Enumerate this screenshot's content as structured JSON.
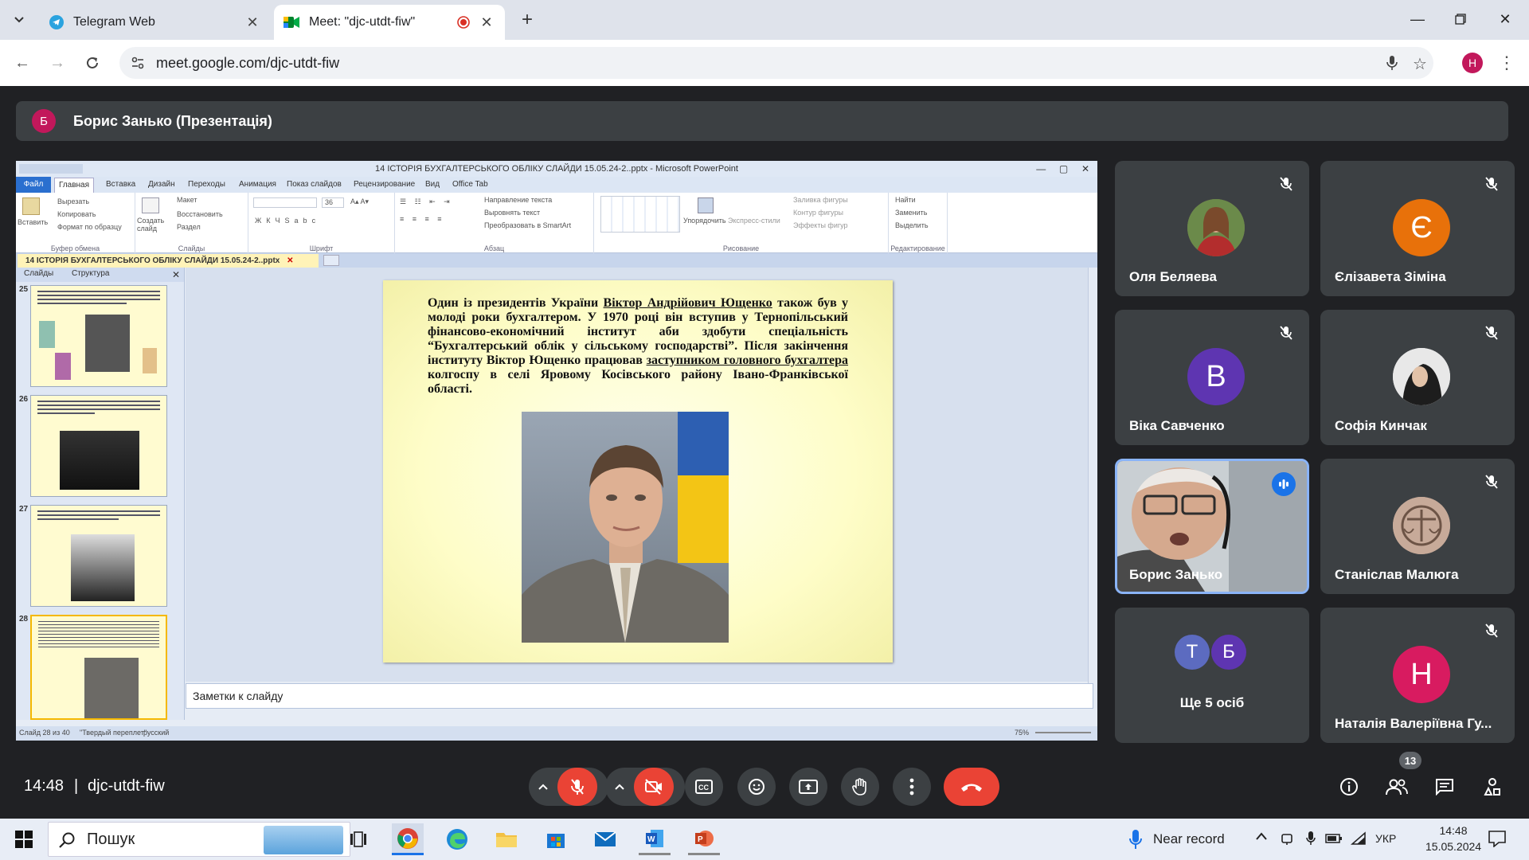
{
  "browser": {
    "tabs": [
      {
        "title": "Telegram Web",
        "favicon": "telegram-icon"
      },
      {
        "title": "Meet: \"djc-utdt-fiw\"",
        "favicon": "meet-icon",
        "recording": true
      }
    ],
    "url": "meet.google.com/djc-utdt-fiw",
    "profile_initial": "H",
    "colors": {
      "tabstrip": "#dfe3eb",
      "profile": "#c2185b"
    }
  },
  "meet": {
    "presenter_banner": {
      "initial": "Б",
      "text": "Борис Занько (Презентація)"
    },
    "presentation": {
      "window_title": "14 ІСТОРІЯ БУХГАЛТЕРСЬКОГО ОБЛІКУ СЛАЙДИ 15.05.24-2..pptx - Microsoft PowerPoint",
      "ribbon_tabs": [
        "Файл",
        "Главная",
        "Вставка",
        "Дизайн",
        "Переходы",
        "Анимация",
        "Показ слайдов",
        "Рецензирование",
        "Вид",
        "Office Tab"
      ],
      "ribbon_groups": {
        "clipboard": {
          "label": "Буфер обмена",
          "paste": "Вставить",
          "cut": "Вырезать",
          "copy": "Копировать",
          "format": "Формат по образцу"
        },
        "slides": {
          "label": "Слайды",
          "new": "Создать слайд",
          "layout": "Макет",
          "reset": "Восстановить",
          "section": "Раздел"
        },
        "font": {
          "label": "Шрифт",
          "size": "36"
        },
        "paragraph": {
          "label": "Абзац",
          "direction": "Направление текста",
          "align": "Выровнять текст",
          "smartart": "Преобразовать в SmartArt"
        },
        "drawing": {
          "label": "Рисование",
          "arrange": "Упорядочить",
          "styles": "Экспресс-стили",
          "fill": "Заливка фигуры",
          "outline": "Контур фигуры",
          "effects": "Эффекты фигур"
        },
        "editing": {
          "label": "Редактирование",
          "find": "Найти",
          "replace": "Заменить",
          "select": "Выделить"
        }
      },
      "doc_tab": "14 ІСТОРІЯ БУХГАЛТЕРСЬКОГО ОБЛІКУ СЛАЙДИ 15.05.24-2..pptx",
      "panel_tabs": [
        "Слайды",
        "Структура"
      ],
      "thumbnails": [
        {
          "num": "25",
          "selected": false
        },
        {
          "num": "26",
          "selected": false
        },
        {
          "num": "27",
          "selected": false
        },
        {
          "num": "28",
          "selected": true
        }
      ],
      "slide": {
        "text_1": "Один із президентів України ",
        "link_1": "Віктор Андрійович Ющенко",
        "text_2": " також був у молоді роки бухгалтером. У 1970 році він вступив у Тернопільський фінансово-економічний інститут аби здобути спеціальність “Бухгалтерський облік у сільському господарстві”. Після закінчення інституту Віктор Ющенко працював ",
        "link_2": "заступником головного бухгалтера",
        "text_3": " колгоспу в селі Яровому Косівського району Івано-Франківської області."
      },
      "notes_placeholder": "Заметки к слайду",
      "status": {
        "slide_count": "Слайд 28 из 40",
        "theme": "\"Твердый переплет\"",
        "language": "русский",
        "zoom": "75%"
      }
    },
    "participants": [
      {
        "name": "Оля Беляева",
        "avatar": "photo",
        "muted": true
      },
      {
        "name": "Єлізавета Зіміна",
        "initial": "Є",
        "color": "#e8710a",
        "muted": true
      },
      {
        "name": "Віка Савченко",
        "initial": "В",
        "color": "#5e35b1",
        "muted": true
      },
      {
        "name": "Софія Кинчак",
        "avatar": "photo",
        "muted": true
      },
      {
        "name": "Борис Занько",
        "avatar": "video",
        "speaking": true
      },
      {
        "name": "Станіслав Малюга",
        "avatar": "photo",
        "muted": true
      },
      {
        "name": "Ще 5 осіб",
        "initials": [
          "Т",
          "Б"
        ],
        "colors": [
          "#5c6bc0",
          "#5e35b1"
        ]
      },
      {
        "name": "Наталія Валеріївна Гу...",
        "initial": "Н",
        "color": "#d81b60",
        "muted": true
      }
    ],
    "bottom_bar": {
      "time": "14:48",
      "separator": "|",
      "meeting_code": "djc-utdt-fiw",
      "people_count": "13",
      "colors": {
        "danger": "#ea4335",
        "control": "#3c4043"
      }
    }
  },
  "taskbar": {
    "search_label": "Пошук",
    "recorder_text": "Near record",
    "language": "УКР",
    "time": "14:48",
    "date": "15.05.2024"
  }
}
